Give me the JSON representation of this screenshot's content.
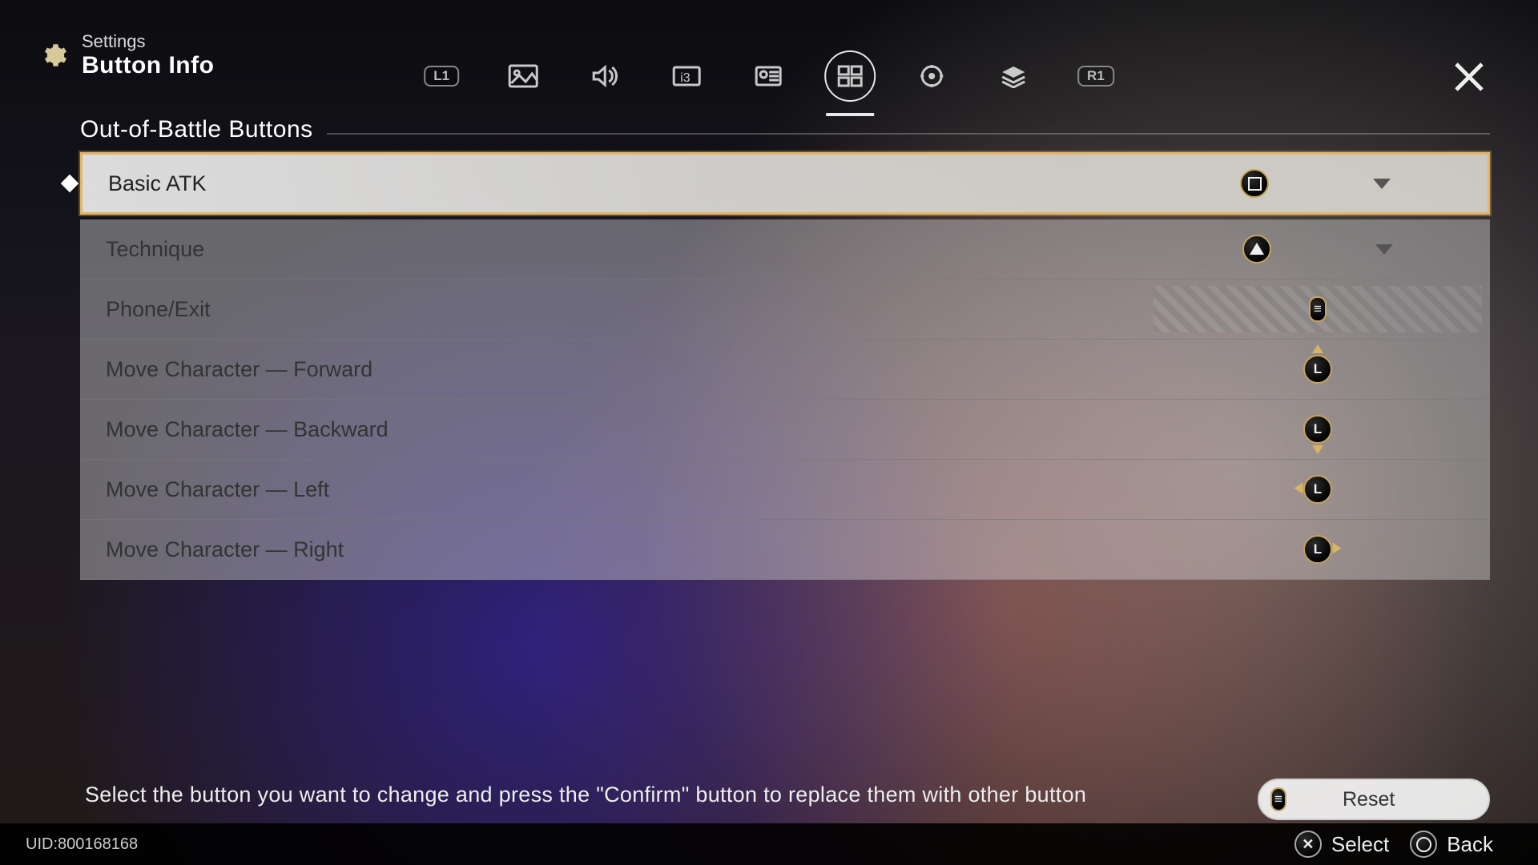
{
  "header": {
    "title_small": "Settings",
    "title_big": "Button Info",
    "bumper_left": "L1",
    "bumper_right": "R1"
  },
  "section": {
    "title": "Out-of-Battle Buttons"
  },
  "rows": [
    {
      "label": "Basic ATK",
      "btn": "square",
      "dropdown": true,
      "locked": false,
      "selected": true
    },
    {
      "label": "Technique",
      "btn": "triangle",
      "dropdown": true,
      "locked": false,
      "selected": false
    },
    {
      "label": "Phone/Exit",
      "btn": "options",
      "dropdown": false,
      "locked": true,
      "selected": false
    },
    {
      "label": "Move Character — Forward",
      "btn": "L-up",
      "dropdown": false,
      "locked": false,
      "selected": false
    },
    {
      "label": "Move Character — Backward",
      "btn": "L-down",
      "dropdown": false,
      "locked": false,
      "selected": false
    },
    {
      "label": "Move Character — Left",
      "btn": "L-left",
      "dropdown": false,
      "locked": false,
      "selected": false
    },
    {
      "label": "Move Character — Right",
      "btn": "L-right",
      "dropdown": false,
      "locked": false,
      "selected": false
    }
  ],
  "hint": "Select the button you want to change and press the \"Confirm\" button to replace them with other button",
  "reset_label": "Reset",
  "uid": "UID:800168168",
  "footer": {
    "select": "Select",
    "back": "Back"
  }
}
